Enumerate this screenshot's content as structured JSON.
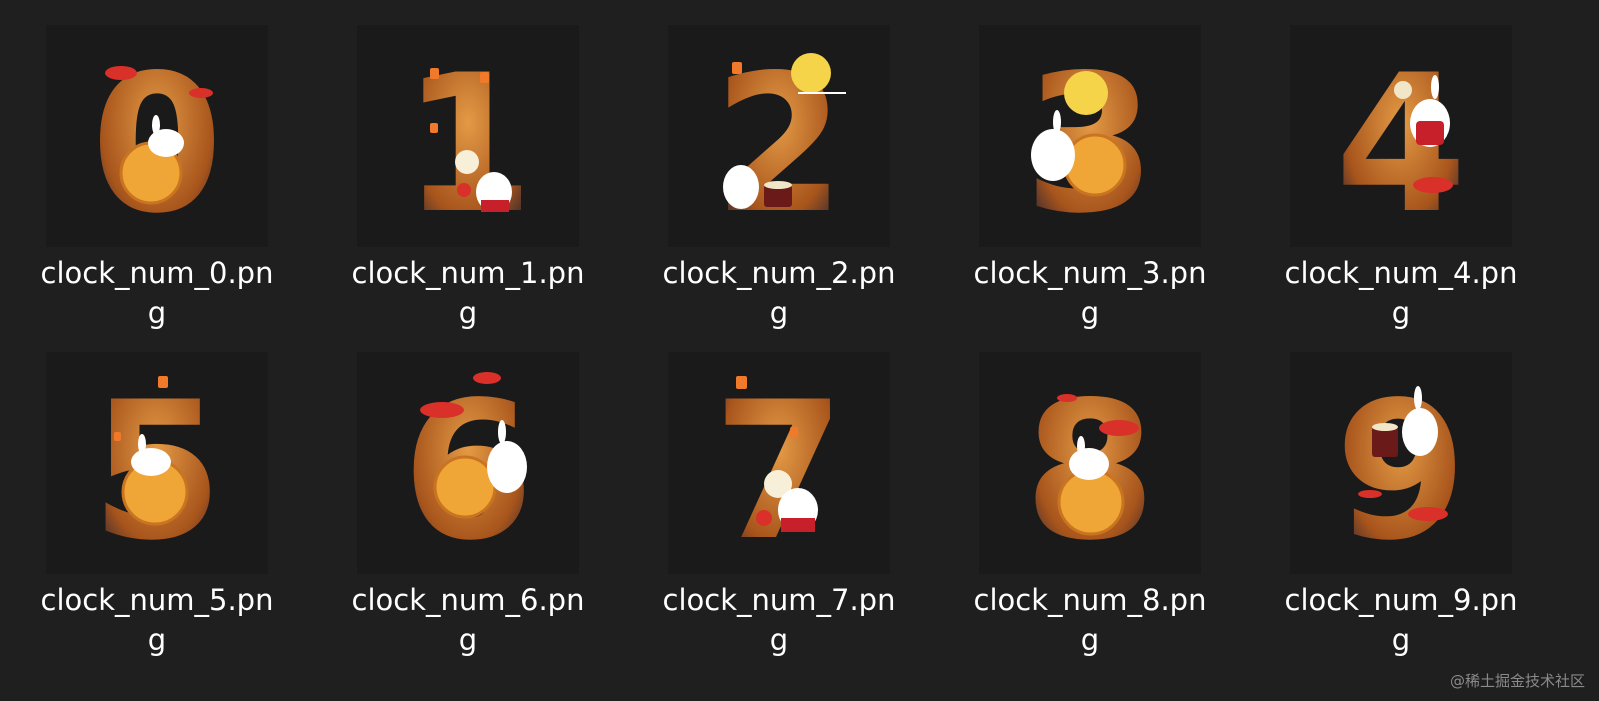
{
  "files": [
    {
      "name": "clock_num_0.png",
      "digit": "0",
      "thumbnail_icon": "moon-rabbit-mooncake-icon"
    },
    {
      "name": "clock_num_1.png",
      "digit": "1",
      "thumbnail_icon": "moon-rabbit-lantern-icon"
    },
    {
      "name": "clock_num_2.png",
      "digit": "2",
      "thumbnail_icon": "moon-rabbit-full-moon-icon"
    },
    {
      "name": "clock_num_3.png",
      "digit": "3",
      "thumbnail_icon": "moon-rabbit-mooncake-icon"
    },
    {
      "name": "clock_num_4.png",
      "digit": "4",
      "thumbnail_icon": "moon-rabbit-cloud-icon"
    },
    {
      "name": "clock_num_5.png",
      "digit": "5",
      "thumbnail_icon": "moon-rabbit-mooncake-icon"
    },
    {
      "name": "clock_num_6.png",
      "digit": "6",
      "thumbnail_icon": "moon-rabbit-mooncake-icon"
    },
    {
      "name": "clock_num_7.png",
      "digit": "7",
      "thumbnail_icon": "moon-rabbit-lantern-icon"
    },
    {
      "name": "clock_num_8.png",
      "digit": "8",
      "thumbnail_icon": "moon-rabbit-mooncake-icon"
    },
    {
      "name": "clock_num_9.png",
      "digit": "9",
      "thumbnail_icon": "moon-rabbit-cloud-icon"
    }
  ],
  "watermark": "@稀土掘金技术社区",
  "colors": {
    "background": "#1f1f1f",
    "thumbnail_bg": "#1a1a1a",
    "digit_fill": "#c97a2e",
    "accent_red": "#d9302a",
    "mooncake": "#f0a637",
    "moon": "#f6d44a",
    "text": "#ffffff"
  }
}
